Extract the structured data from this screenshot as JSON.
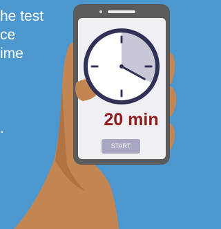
{
  "background": {
    "color": "#4d97cf",
    "text_lines": [
      "he test",
      "ce",
      "ime",
      "."
    ]
  },
  "timer": {
    "label": "20 min",
    "start_label": "START",
    "elapsed_fraction": 0.33,
    "colors": {
      "ring": "#2f3157",
      "fill": "#c7c7d6",
      "face": "#ffffff",
      "time_text": "#8f1d1d",
      "button": "#a7a7c1"
    }
  },
  "phone": {
    "body_color": "#5b5b5b",
    "screen_color": "#f0eff4"
  },
  "hand": {
    "skin_color": "#c38552"
  }
}
